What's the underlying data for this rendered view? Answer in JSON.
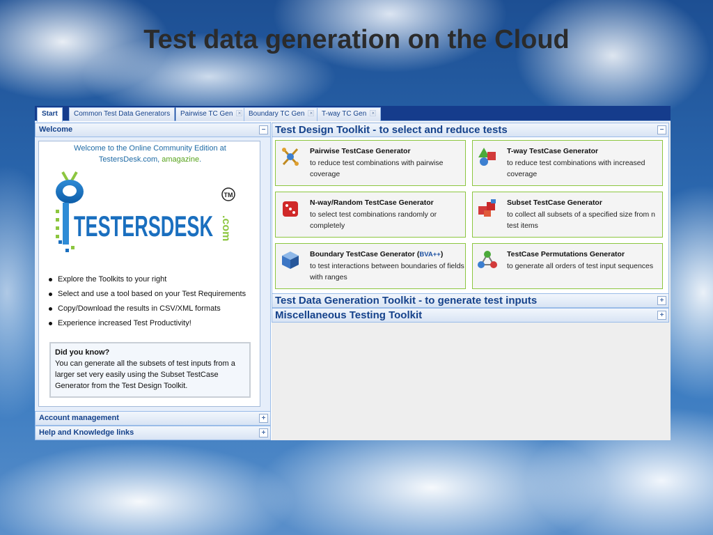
{
  "slide_title": "Test data generation on the Cloud",
  "tabs": [
    {
      "label": "Start",
      "closable": false
    },
    {
      "label": "Common Test Data Generators",
      "closable": false
    },
    {
      "label": "Pairwise TC Gen",
      "closable": true
    },
    {
      "label": "Boundary TC Gen",
      "closable": true
    },
    {
      "label": "T-way TC Gen",
      "closable": true
    }
  ],
  "left": {
    "welcome_header": "Welcome",
    "welcome_line1": "Welcome to the Online Community Edition at",
    "welcome_site": "TestersDesk.com, ",
    "welcome_amazine": "amagazine",
    "welcome_dot": ".",
    "logo_text": "TESTERSDESK",
    "logo_com": ".com",
    "logo_tm": "TM",
    "bullets": [
      "Explore the Toolkits to your right",
      "Select and use a tool based on your Test Requirements",
      "Copy/Download the results in CSV/XML formats",
      "Experience increased Test Productivity!"
    ],
    "did_you_know_title": "Did you know?",
    "did_you_know_text": "You can generate all the subsets of test inputs from a larger set very easily using the Subset TestCase Generator from the Test Design Toolkit.",
    "account_header": "Account management",
    "help_header": "Help and Knowledge links",
    "collapse_symbol": "−",
    "expand_symbol": "+"
  },
  "right": {
    "design_toolkit_header": "Test Design Toolkit - to select and reduce tests",
    "data_toolkit_header": "Test Data Generation Toolkit - to generate test inputs",
    "misc_toolkit_header": "Miscellaneous Testing Toolkit",
    "cards": [
      {
        "title": "Pairwise TestCase Generator",
        "desc": "to reduce test combinations with pairwise coverage",
        "icon": "pairwise-icon"
      },
      {
        "title": "T-way TestCase Generator",
        "desc": "to reduce test combinations with increased coverage",
        "icon": "shapes-icon"
      },
      {
        "title": "N-way/Random TestCase Generator",
        "desc": "to select test combinations randomly or completely",
        "icon": "dice-icon"
      },
      {
        "title": "Subset TestCase Generator",
        "desc": "to collect all subsets of a specified size from n test items",
        "icon": "blocks-icon"
      },
      {
        "title": "Boundary TestCase Generator (",
        "title_tag": "BVA++",
        "title_end": ")",
        "desc": "to test interactions between boundaries of fields with ranges",
        "icon": "cube-icon"
      },
      {
        "title": "TestCase Permutations Generator",
        "desc": "to generate all orders of test input sequences",
        "icon": "molecule-icon"
      }
    ]
  },
  "colors": {
    "header_text": "#15428b",
    "card_border": "#8cc63f",
    "tabbar": "#153c8c"
  }
}
